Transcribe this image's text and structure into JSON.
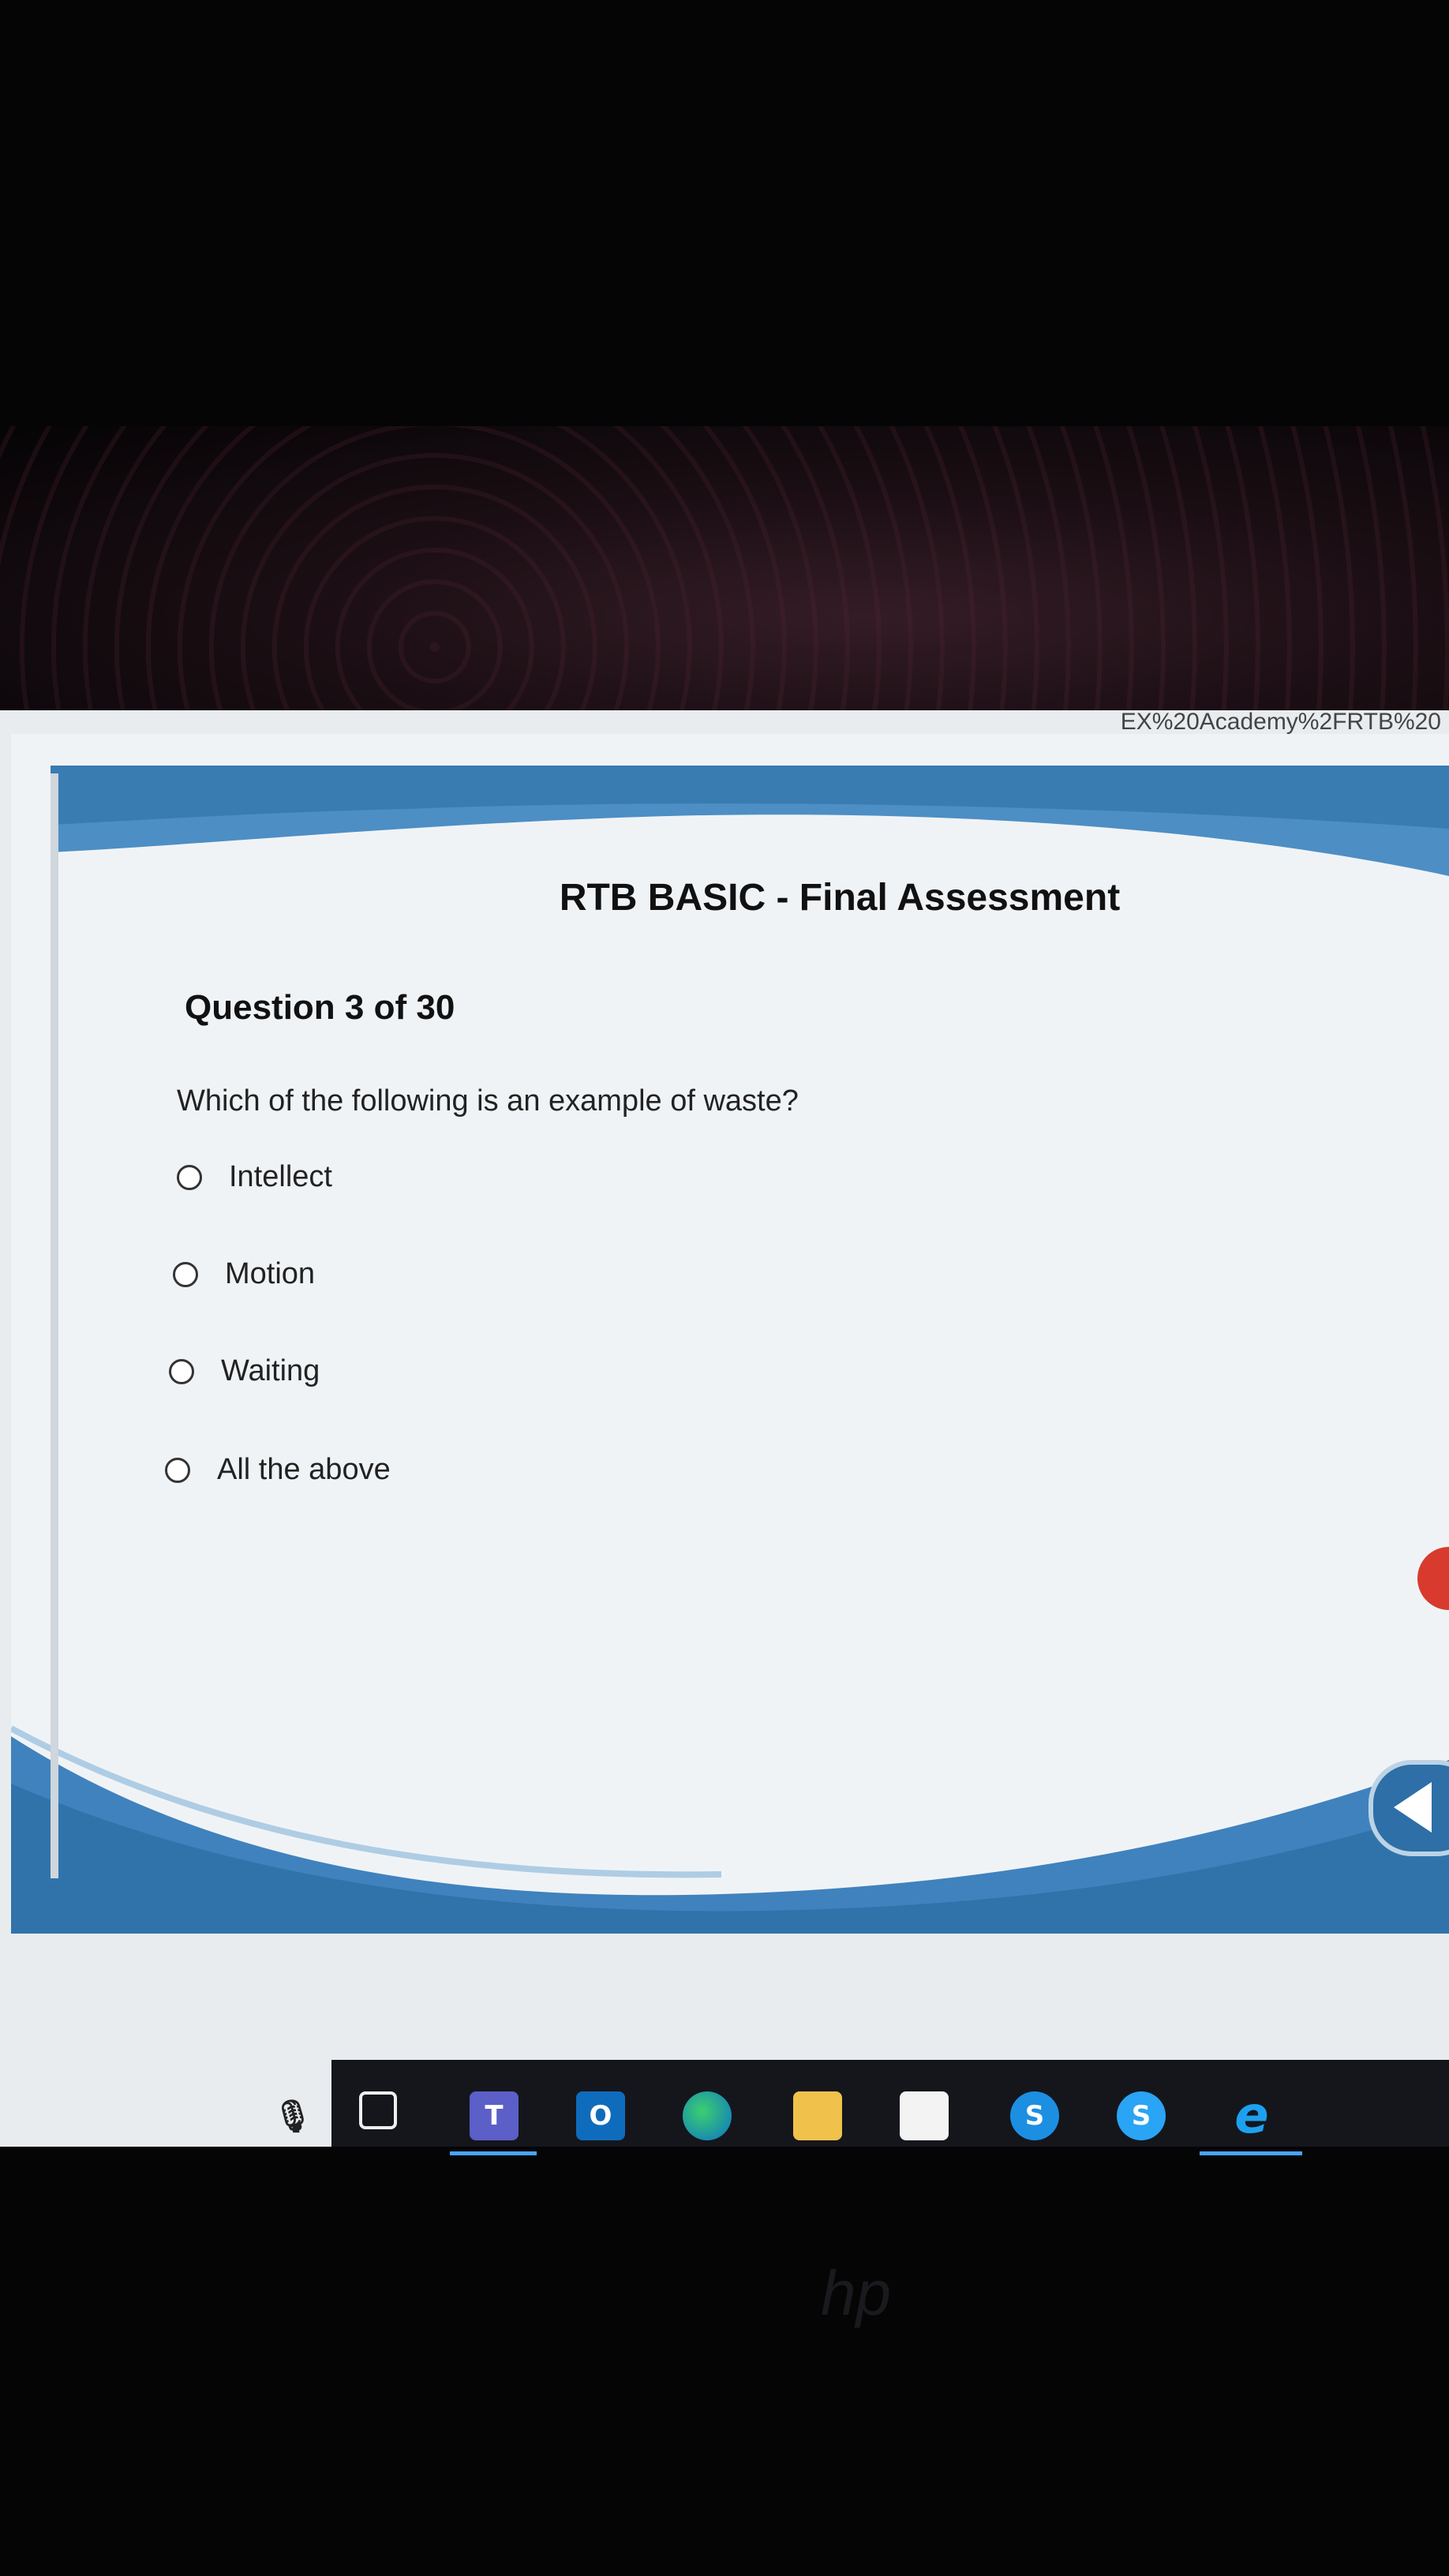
{
  "browser": {
    "url_fragment": "EX%20Academy%2FRTB%20"
  },
  "slide": {
    "title": "RTB BASIC - Final Assessment",
    "question_number": "Question 3 of 30",
    "question_text": "Which of the following is an example of waste?",
    "options": [
      "Intellect",
      "Motion",
      "Waiting",
      "All the above"
    ],
    "selected_option": null
  },
  "taskbar": {
    "icons": [
      "microphone-icon",
      "task-view-icon",
      "teams-icon",
      "outlook-icon",
      "edge-icon",
      "file-explorer-icon",
      "mail-icon",
      "skype-icon",
      "skype-business-icon",
      "internet-explorer-icon"
    ],
    "teams_label": "T",
    "outlook_label": "O",
    "skype_label": "S",
    "skype_business_label": "S",
    "ie_label": "e"
  },
  "colors": {
    "accent_blue": "#2d6fa6",
    "wave_light": "#9ec3e0",
    "taskbar": "#14161c"
  }
}
